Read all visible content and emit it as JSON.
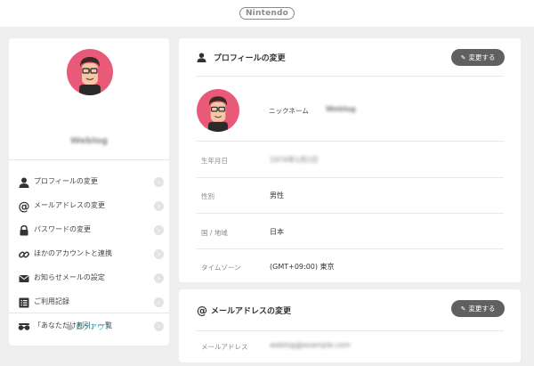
{
  "header": {
    "logo_text": "Nintendo"
  },
  "sidebar": {
    "username": "Weblog",
    "items": [
      {
        "label": "プロフィールの変更",
        "icon": "person-icon"
      },
      {
        "label": "メールアドレスの変更",
        "icon": "at-icon"
      },
      {
        "label": "パスワードの変更",
        "icon": "lock-icon"
      },
      {
        "label": "ほかのアカウントと連携",
        "icon": "link-icon"
      },
      {
        "label": "お知らせメールの設定",
        "icon": "envelope-icon"
      },
      {
        "label": "ご利用記録",
        "icon": "list-icon"
      },
      {
        "label": "「あなただけ割引」一覧",
        "icon": "glasses-icon"
      }
    ],
    "chevron": "›",
    "logout_label": "ログアウト"
  },
  "profile": {
    "title": "プロフィールの変更",
    "edit_label": "変更する",
    "nickname_label": "ニックネーム",
    "nickname_value": "Weblog",
    "rows": [
      {
        "label": "生年月日",
        "value": "1974年1月1日",
        "blurred": true
      },
      {
        "label": "性別",
        "value": "男性"
      },
      {
        "label": "国 / 地域",
        "value": "日本"
      },
      {
        "label": "タイムゾーン",
        "value": "(GMT+09:00) 東京"
      }
    ]
  },
  "email": {
    "title": "メールアドレスの変更",
    "edit_label": "変更する",
    "address_label": "メールアドレス",
    "address_value": "weblog@example.com"
  },
  "colors": {
    "accent": "#3ab2c4",
    "button": "#606060",
    "avatar_bg": "#e85a78"
  }
}
